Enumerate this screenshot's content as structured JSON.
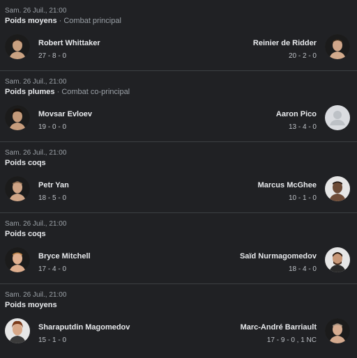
{
  "fights": [
    {
      "date": "Sam. 26 Juil., 21:00",
      "weight_class": "Poids moyens",
      "separator": " · ",
      "fight_type": "Combat principal",
      "fighter1": {
        "name": "Robert Whittaker",
        "record": "27 - 8 - 0",
        "avatar": "fighter-photo"
      },
      "fighter2": {
        "name": "Reinier de Ridder",
        "record": "20 - 2 - 0",
        "avatar": "fighter-photo"
      }
    },
    {
      "date": "Sam. 26 Juil., 21:00",
      "weight_class": "Poids plumes",
      "separator": " · ",
      "fight_type": "Combat co-principal",
      "fighter1": {
        "name": "Movsar Evloev",
        "record": "19 - 0 - 0",
        "avatar": "fighter-photo"
      },
      "fighter2": {
        "name": "Aaron Pico",
        "record": "13 - 4 - 0",
        "avatar": "placeholder-person-icon"
      }
    },
    {
      "date": "Sam. 26 Juil., 21:00",
      "weight_class": "Poids coqs",
      "separator": "",
      "fight_type": "",
      "fighter1": {
        "name": "Petr Yan",
        "record": "18 - 5 - 0",
        "avatar": "fighter-photo"
      },
      "fighter2": {
        "name": "Marcus McGhee",
        "record": "10 - 1 - 0",
        "avatar": "fighter-photo"
      }
    },
    {
      "date": "Sam. 26 Juil., 21:00",
      "weight_class": "Poids coqs",
      "separator": "",
      "fight_type": "",
      "fighter1": {
        "name": "Bryce Mitchell",
        "record": "17 - 4 - 0",
        "avatar": "fighter-photo"
      },
      "fighter2": {
        "name": "Saïd Nurmagomedov",
        "record": "18 - 4 - 0",
        "avatar": "fighter-photo"
      }
    },
    {
      "date": "Sam. 26 Juil., 21:00",
      "weight_class": "Poids moyens",
      "separator": "",
      "fight_type": "",
      "fighter1": {
        "name": "Sharaputdin Magomedov",
        "record": "15 - 1 - 0",
        "avatar": "fighter-photo"
      },
      "fighter2": {
        "name": "Marc-André Barriault",
        "record": "17 - 9 - 0 , 1 NC",
        "avatar": "fighter-photo"
      }
    }
  ],
  "colors": {
    "background": "#202124",
    "divider": "#3c4043",
    "primary_text": "#e8eaed",
    "secondary_text": "#9aa0a6"
  }
}
